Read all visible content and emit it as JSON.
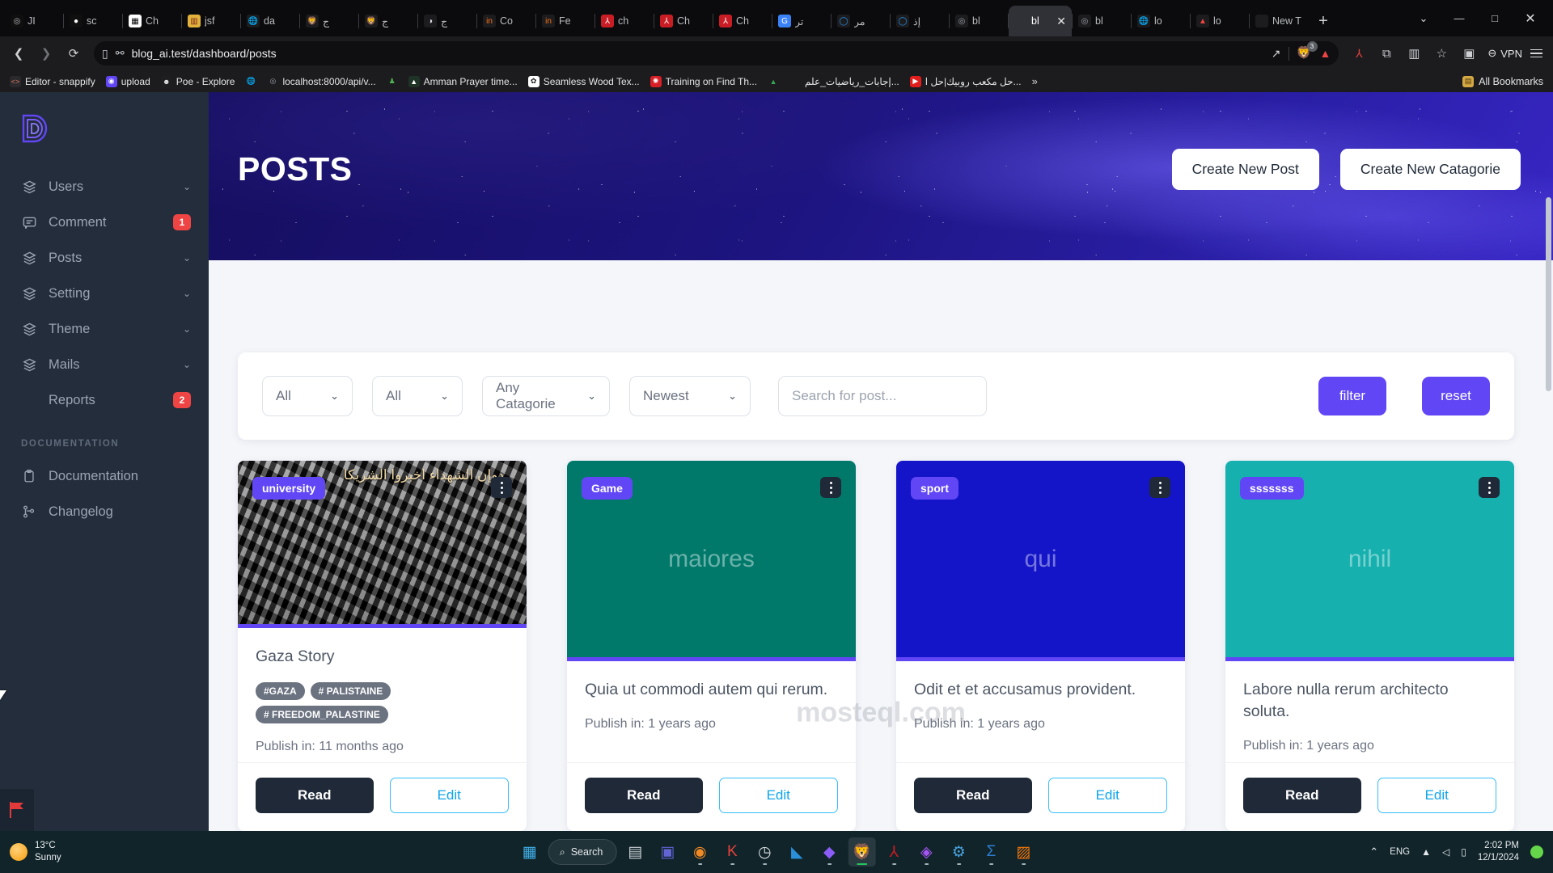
{
  "browser": {
    "tabs": [
      {
        "title": "JI",
        "icon": "openai-icon",
        "fav_bg": "#0f0f0f",
        "fav_glyph": "◎",
        "fav_color": "#b9bbbe",
        "active": false
      },
      {
        "title": "sc",
        "icon": "github-icon",
        "fav_bg": "#0f0f0f",
        "fav_glyph": "●",
        "fav_color": "#ffffff",
        "active": false
      },
      {
        "title": "Ch",
        "icon": "dhamani-icon",
        "fav_bg": "#ffffff",
        "fav_glyph": "▦",
        "fav_color": "#000000",
        "active": false
      },
      {
        "title": "jsf",
        "icon": "jsfx-icon",
        "fav_bg": "#e3b23c",
        "fav_glyph": "▥",
        "fav_color": "#7a1f1f",
        "active": false
      },
      {
        "title": "da",
        "icon": "globe-icon",
        "fav_bg": "#1c1c1f",
        "fav_glyph": "🌐",
        "fav_color": "#c9ccd1",
        "active": false
      },
      {
        "title": "ج",
        "icon": "brave-icon",
        "fav_bg": "#1c1c1f",
        "fav_glyph": "🦁",
        "fav_color": "#f97316",
        "active": false
      },
      {
        "title": "ج",
        "icon": "brave-icon",
        "fav_bg": "#1c1c1f",
        "fav_glyph": "🦁",
        "fav_color": "#f97316",
        "active": false
      },
      {
        "title": "ج",
        "icon": "shield-icon",
        "fav_bg": "#1c1c1f",
        "fav_glyph": "◑",
        "fav_color": "#dfe3e8",
        "active": false
      },
      {
        "title": "Co",
        "icon": "in-icon",
        "fav_bg": "#1c1c1f",
        "fav_glyph": "in",
        "fav_color": "#f97316",
        "active": false
      },
      {
        "title": "Fe",
        "icon": "in-icon",
        "fav_bg": "#1c1c1f",
        "fav_glyph": "in",
        "fav_color": "#f97316",
        "active": false
      },
      {
        "title": "ch",
        "icon": "pdf-icon",
        "fav_bg": "#c81d25",
        "fav_glyph": "⅄",
        "fav_color": "#ffffff",
        "active": false
      },
      {
        "title": "Ch",
        "icon": "pdf-icon",
        "fav_bg": "#c81d25",
        "fav_glyph": "⅄",
        "fav_color": "#ffffff",
        "active": false
      },
      {
        "title": "Ch",
        "icon": "pdf-icon",
        "fav_bg": "#c81d25",
        "fav_glyph": "⅄",
        "fav_color": "#ffffff",
        "active": false
      },
      {
        "title": "تر",
        "icon": "google-translate-icon",
        "fav_bg": "#3b82f6",
        "fav_glyph": "G",
        "fav_color": "#ffffff",
        "active": false
      },
      {
        "title": "مر",
        "icon": "outlook-icon",
        "fav_bg": "#1c1c1f",
        "fav_glyph": "◯",
        "fav_color": "#2196f3",
        "active": false
      },
      {
        "title": "إذ",
        "icon": "outlook-icon",
        "fav_bg": "#1c1c1f",
        "fav_glyph": "◯",
        "fav_color": "#2196f3",
        "active": false
      },
      {
        "title": "bl",
        "icon": "openai-icon",
        "fav_bg": "#1c1c1f",
        "fav_glyph": "◎",
        "fav_color": "#9aa0a6",
        "active": false
      },
      {
        "title": "bl",
        "icon": "blog-icon",
        "fav_bg": "#303136",
        "fav_glyph": "",
        "fav_color": "#ffffff",
        "active": true
      },
      {
        "title": "bl",
        "icon": "openai-icon",
        "fav_bg": "#1c1c1f",
        "fav_glyph": "◎",
        "fav_color": "#9aa0a6",
        "active": false
      },
      {
        "title": "lo",
        "icon": "globe-icon",
        "fav_bg": "#1c1c1f",
        "fav_glyph": "🌐",
        "fav_color": "#c9ccd1",
        "active": false
      },
      {
        "title": "lo",
        "icon": "laravel-icon",
        "fav_bg": "#1c1c1f",
        "fav_glyph": "▲",
        "fav_color": "#ef4444",
        "active": false
      },
      {
        "title": "New T",
        "icon": "newtab-icon",
        "fav_bg": "#1c1c1f",
        "fav_glyph": "",
        "fav_color": "#c9ccd1",
        "active": false
      }
    ],
    "new_tab_label": "+",
    "tab_close_label": "✕",
    "tablist_chevron": "⌄",
    "window_controls": {
      "minimize": "—",
      "maximize": "□",
      "close": "✕"
    },
    "nav": {
      "back": "❮",
      "forward": "❯",
      "reload": "⟳",
      "reader": "▯"
    },
    "url": "blog_ai.test/dashboard/posts",
    "url_actions": {
      "share": "↗",
      "extension_count": "3",
      "brave_glyph": "🦁",
      "laravel_glyph": "▲"
    },
    "vpn_label": "VPN",
    "bookmarks": [
      {
        "label": "Editor - snappify",
        "icon": "code-icon",
        "bg": "#2a2a2e",
        "glyph": "<>",
        "color": "#e07a5f"
      },
      {
        "label": "upload",
        "icon": "upload-icon",
        "bg": "#6146f5",
        "glyph": "◉",
        "color": "#ffffff"
      },
      {
        "label": "Poe - Explore",
        "icon": "poe-icon",
        "bg": "#1e1e20",
        "glyph": "☻",
        "color": "#e8e8e8"
      },
      {
        "label": "",
        "icon": "globe-icon",
        "bg": "#1c1c1f",
        "glyph": "🌐",
        "color": "#c9ccd1"
      },
      {
        "label": "localhost:8000/api/v...",
        "icon": "openai-icon",
        "bg": "#1c1c1f",
        "glyph": "◎",
        "color": "#9aa0a6"
      },
      {
        "label": "",
        "icon": "chess-icon",
        "bg": "#1c1c1f",
        "glyph": "♟",
        "color": "#4caf50"
      },
      {
        "label": "Amman Prayer time...",
        "icon": "mosque-icon",
        "bg": "#1f3326",
        "glyph": "▲",
        "color": "#ffffff"
      },
      {
        "label": "Seamless Wood Tex...",
        "icon": "texture-icon",
        "bg": "#ffffff",
        "glyph": "✿",
        "color": "#1c1c1f"
      },
      {
        "label": "Training on Find Th...",
        "icon": "spiral-icon",
        "bg": "#d61f26",
        "glyph": "✺",
        "color": "#ffffff"
      },
      {
        "label": "",
        "icon": "gdrive-icon",
        "bg": "#1c1c1f",
        "glyph": "▲",
        "color": "#34a853"
      },
      {
        "label": "إجابات_رياضيات_علم...",
        "icon": "gdoc-icon",
        "bg": "#1c1c1f",
        "glyph": "",
        "color": "#c9ccd1"
      },
      {
        "label": "حل مكعب روبيك|حل ا...",
        "icon": "youtube-icon",
        "bg": "#e11d1d",
        "glyph": "▶",
        "color": "#ffffff"
      }
    ],
    "bookmarks_overflow": "»",
    "all_bookmarks_label": "All Bookmarks",
    "folder_glyph": "▤"
  },
  "sidebar": {
    "logo_name": "devias-logo",
    "items": [
      {
        "label": "Users",
        "icon": "layers-icon",
        "chevron": "⌄",
        "badge": null
      },
      {
        "label": "Comment",
        "icon": "comment-icon",
        "chevron": "",
        "badge": "1"
      },
      {
        "label": "Posts",
        "icon": "layers-icon",
        "chevron": "⌄",
        "badge": null
      },
      {
        "label": "Setting",
        "icon": "layers-icon",
        "chevron": "⌄",
        "badge": null
      },
      {
        "label": "Theme",
        "icon": "layers-icon",
        "chevron": "⌄",
        "badge": null
      },
      {
        "label": "Mails",
        "icon": "layers-icon",
        "chevron": "⌄",
        "badge": null
      },
      {
        "label": "Reports",
        "icon": "",
        "chevron": "",
        "badge": "2"
      }
    ],
    "section_title": "DOCUMENTATION",
    "doc_items": [
      {
        "label": "Documentation",
        "icon": "clipboard-icon"
      },
      {
        "label": "Changelog",
        "icon": "git-branch-icon"
      }
    ],
    "accent": "#6146f5",
    "bg": "#232d3b",
    "badge_color": "#ef4444"
  },
  "hero": {
    "title": "POSTS",
    "create_post_label": "Create New Post",
    "create_category_label": "Create New Catagorie"
  },
  "filters": {
    "select_1": {
      "value": "All",
      "chevron": "⌄"
    },
    "select_2": {
      "value": "All",
      "chevron": "⌄"
    },
    "select_3": {
      "value": "Any Catagorie",
      "chevron": "⌄"
    },
    "select_4": {
      "value": "Newest",
      "chevron": "⌄"
    },
    "search_placeholder": "Search for post...",
    "search_value": "",
    "filter_label": "filter",
    "reset_label": "reset",
    "button_color": "#6146f5"
  },
  "cards": [
    {
      "category": "university",
      "image_kind": "photo",
      "image_text": "",
      "image_bg": "#6d6d6d",
      "image_caption_ar": "دوإن الشهداء اخبروا الشريكا",
      "title": "Gaza Story",
      "tags": [
        "#GAZA",
        "# PALISTAINE",
        "# FREEDOM_PALASTINE"
      ],
      "publish": "Publish in: 11 months ago",
      "read_label": "Read",
      "edit_label": "Edit"
    },
    {
      "category": "Game",
      "image_kind": "placeholder",
      "image_text": "maiores",
      "image_bg": "#00796b",
      "image_caption_ar": "",
      "title": "Quia ut commodi autem qui rerum.",
      "tags": [],
      "publish": "Publish in: 1 years ago",
      "read_label": "Read",
      "edit_label": "Edit"
    },
    {
      "category": "sport",
      "image_kind": "placeholder",
      "image_text": "qui",
      "image_bg": "#1414c8",
      "image_caption_ar": "",
      "title": "Odit et et accusamus provident.",
      "tags": [],
      "publish": "Publish in: 1 years ago",
      "read_label": "Read",
      "edit_label": "Edit"
    },
    {
      "category": "sssssss",
      "image_kind": "placeholder",
      "image_text": "nihil",
      "image_bg": "#16b0ae",
      "image_caption_ar": "",
      "title": "Labore nulla rerum architecto soluta.",
      "tags": [],
      "publish": "Publish in: 1 years ago",
      "read_label": "Read",
      "edit_label": "Edit"
    }
  ],
  "watermark": "mosteql.com",
  "taskbar": {
    "weather_temp": "13°C",
    "weather_desc": "Sunny",
    "search_label": "Search",
    "apps": [
      {
        "name": "start-button",
        "glyph": "▦",
        "color": "#41b0e8",
        "dot": false,
        "active": false
      },
      {
        "name": "task-view",
        "glyph": "▤",
        "color": "#cfd4d8",
        "dot": false,
        "active": false
      },
      {
        "name": "teams",
        "glyph": "▣",
        "color": "#6264d4",
        "dot": false,
        "active": false
      },
      {
        "name": "firefox",
        "glyph": "◉",
        "color": "#f08a24",
        "dot": true,
        "active": false
      },
      {
        "name": "hyper",
        "glyph": "K",
        "color": "#e8413a",
        "dot": true,
        "active": false
      },
      {
        "name": "clock",
        "glyph": "◷",
        "color": "#d8dde1",
        "dot": true,
        "active": false
      },
      {
        "name": "vscode",
        "glyph": "◣",
        "color": "#2a8fd8",
        "dot": false,
        "active": false
      },
      {
        "name": "explorer",
        "glyph": "◆",
        "color": "#8b5cf6",
        "dot": true,
        "active": false
      },
      {
        "name": "brave",
        "glyph": "🦁",
        "color": "#f36522",
        "dot": true,
        "active": true
      },
      {
        "name": "acrobat",
        "glyph": "⅄",
        "color": "#c81d25",
        "dot": true,
        "active": false
      },
      {
        "name": "app-purple",
        "glyph": "◈",
        "color": "#a855f7",
        "dot": true,
        "active": false
      },
      {
        "name": "settings",
        "glyph": "⚙",
        "color": "#4aa3df",
        "dot": true,
        "active": false
      },
      {
        "name": "terminal",
        "glyph": "Σ",
        "color": "#2f7fd0",
        "dot": true,
        "active": false
      },
      {
        "name": "postman",
        "glyph": "▨",
        "color": "#f2760c",
        "dot": true,
        "active": false
      }
    ],
    "tray_chevron": "⌃",
    "language": "ENG",
    "wifi_glyph": "▲",
    "volume_glyph": "◁",
    "battery_glyph": "▯",
    "time": "2:02 PM",
    "date": "12/1/2024"
  }
}
